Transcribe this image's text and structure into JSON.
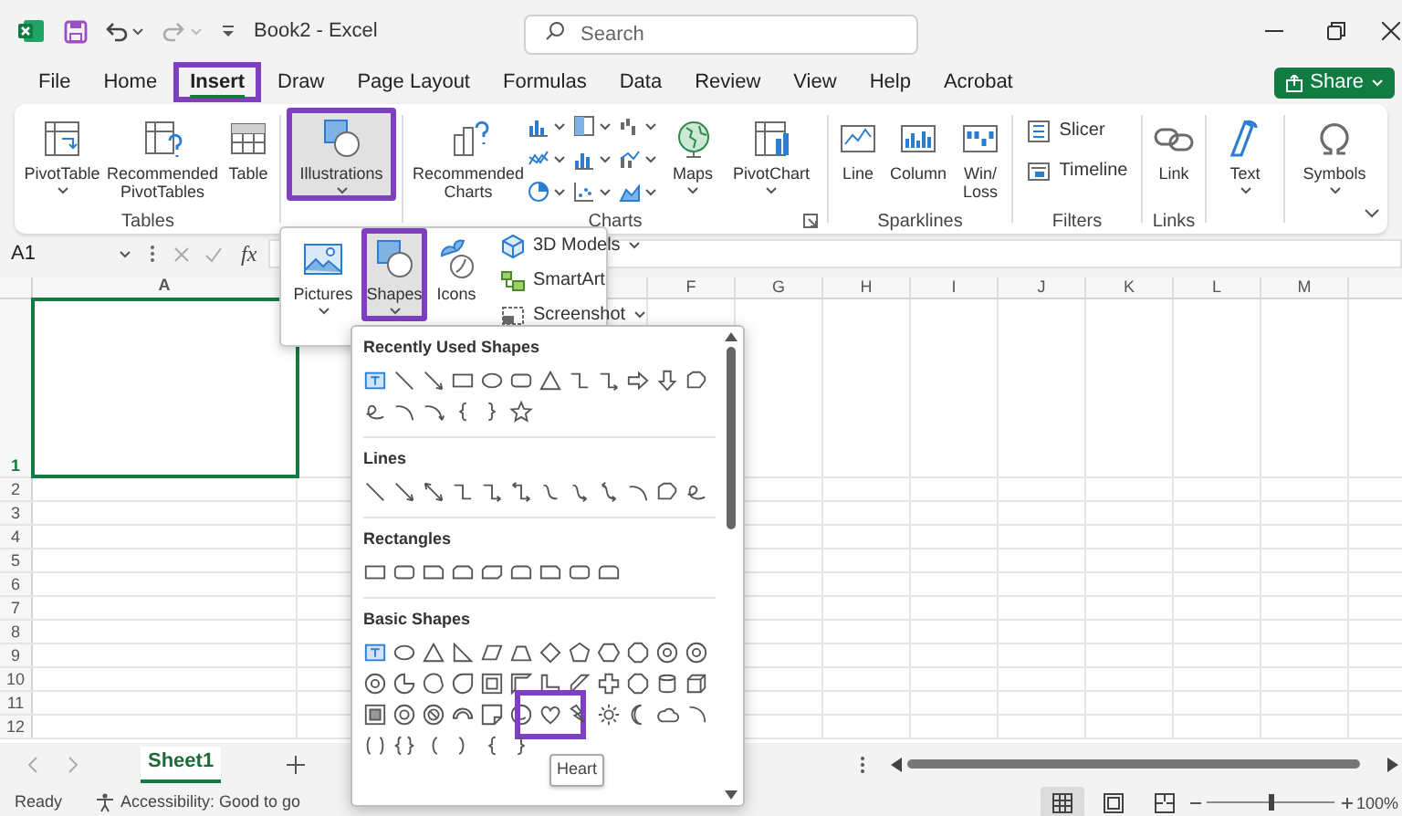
{
  "title_bar": {
    "title": "Book2 - Excel",
    "search": {
      "placeholder": "Search"
    }
  },
  "tabs": [
    {
      "label": "File",
      "selected": false,
      "highlighted": false
    },
    {
      "label": "Home",
      "selected": false,
      "highlighted": false
    },
    {
      "label": "Insert",
      "selected": true,
      "highlighted": true
    },
    {
      "label": "Draw",
      "selected": false,
      "highlighted": false
    },
    {
      "label": "Page Layout",
      "selected": false,
      "highlighted": false
    },
    {
      "label": "Formulas",
      "selected": false,
      "highlighted": false
    },
    {
      "label": "Data",
      "selected": false,
      "highlighted": false
    },
    {
      "label": "Review",
      "selected": false,
      "highlighted": false
    },
    {
      "label": "View",
      "selected": false,
      "highlighted": false
    },
    {
      "label": "Help",
      "selected": false,
      "highlighted": false
    },
    {
      "label": "Acrobat",
      "selected": false,
      "highlighted": false
    }
  ],
  "share_button": {
    "label": "Share"
  },
  "ribbon": {
    "groups": [
      {
        "label": "Tables",
        "launcher": false,
        "items": [
          {
            "kind": "large",
            "label": "PivotTable",
            "dropdown": true,
            "pressed": false,
            "highlighted": false
          },
          {
            "kind": "large",
            "label": "Recommended PivotTables",
            "dropdown": false,
            "pressed": false,
            "highlighted": false
          },
          {
            "kind": "large",
            "label": "Table",
            "dropdown": false,
            "pressed": false,
            "highlighted": false
          }
        ]
      },
      {
        "launcher": false,
        "items": [
          {
            "kind": "large",
            "label": "Illustrations",
            "dropdown": true,
            "pressed": true,
            "highlighted": true
          }
        ]
      },
      {
        "label": "Charts",
        "launcher": true,
        "items": [
          {
            "kind": "large",
            "label": "Recommended Charts",
            "dropdown": false,
            "pressed": false,
            "highlighted": false
          },
          {
            "kind": "chart-grid"
          },
          {
            "kind": "large",
            "label": "Maps",
            "dropdown": true,
            "pressed": false,
            "highlighted": false
          },
          {
            "kind": "large",
            "label": "PivotChart",
            "dropdown": true,
            "pressed": false,
            "highlighted": false
          }
        ]
      },
      {
        "label": "Sparklines",
        "launcher": false,
        "items": [
          {
            "kind": "large",
            "label": "Line",
            "dropdown": false,
            "pressed": false,
            "highlighted": false
          },
          {
            "kind": "large",
            "label": "Column",
            "dropdown": false,
            "pressed": false,
            "highlighted": false
          },
          {
            "kind": "large",
            "label": "Win/ Loss",
            "dropdown": false,
            "pressed": false,
            "highlighted": false
          }
        ]
      },
      {
        "label": "Filters",
        "launcher": false,
        "items": [
          {
            "kind": "small",
            "label": "Slicer",
            "dropdown": false,
            "pressed": false,
            "highlighted": false
          },
          {
            "kind": "small",
            "label": "Timeline",
            "dropdown": false,
            "pressed": false,
            "highlighted": false
          }
        ]
      },
      {
        "label": "Links",
        "launcher": false,
        "items": [
          {
            "kind": "large",
            "label": "Link",
            "dropdown": false,
            "pressed": false,
            "highlighted": false
          }
        ]
      },
      {
        "launcher": false,
        "items": [
          {
            "kind": "large",
            "label": "Text",
            "dropdown": true,
            "pressed": false,
            "highlighted": false
          }
        ]
      },
      {
        "launcher": false,
        "items": [
          {
            "kind": "large",
            "label": "Symbols",
            "dropdown": true,
            "pressed": false,
            "highlighted": false
          }
        ]
      }
    ]
  },
  "illustrations_menu": {
    "items": [
      {
        "kind": "large",
        "label": "Pictures",
        "dropdown": true,
        "pressed": false,
        "highlighted": false
      },
      {
        "kind": "large",
        "label": "Shapes",
        "dropdown": true,
        "pressed": true,
        "highlighted": true
      },
      {
        "kind": "large",
        "label": "Icons",
        "dropdown": false,
        "pressed": false,
        "highlighted": false
      },
      {
        "kind": "small",
        "label": "3D Models",
        "dropdown": true,
        "pressed": false,
        "highlighted": false
      },
      {
        "kind": "small",
        "label": "SmartArt",
        "dropdown": false,
        "pressed": false,
        "highlighted": false
      },
      {
        "kind": "small",
        "label": "Screenshot",
        "dropdown": true,
        "pressed": false,
        "highlighted": false
      }
    ]
  },
  "formula_bar": {
    "name_box": "A1",
    "function_label": "fx"
  },
  "grid": {
    "columns": [
      {
        "label": "A",
        "selected": true
      },
      {
        "label": "F",
        "selected": false
      },
      {
        "label": "G",
        "selected": false
      },
      {
        "label": "H",
        "selected": false
      },
      {
        "label": "I",
        "selected": false
      },
      {
        "label": "J",
        "selected": false
      },
      {
        "label": "K",
        "selected": false
      },
      {
        "label": "L",
        "selected": false
      },
      {
        "label": "M",
        "selected": false
      }
    ],
    "rows": [
      {
        "label": "1",
        "selected": true
      },
      {
        "label": "2",
        "selected": false
      },
      {
        "label": "3",
        "selected": false
      },
      {
        "label": "4",
        "selected": false
      },
      {
        "label": "5",
        "selected": false
      },
      {
        "label": "6",
        "selected": false
      },
      {
        "label": "7",
        "selected": false
      },
      {
        "label": "8",
        "selected": false
      },
      {
        "label": "9",
        "selected": false
      },
      {
        "label": "10",
        "selected": false
      },
      {
        "label": "11",
        "selected": false
      },
      {
        "label": "12",
        "selected": false
      }
    ]
  },
  "shapes_gallery": {
    "sections": [
      {
        "title": "Recently Used Shapes"
      },
      {
        "title": "Lines"
      },
      {
        "title": "Rectangles"
      },
      {
        "title": "Basic Shapes"
      }
    ],
    "hovered": {
      "highlighted": true,
      "tooltip": "Heart"
    }
  },
  "sheet_tabs": [
    {
      "label": "Sheet1",
      "selected": true
    }
  ],
  "status_bar": {
    "status": "Ready",
    "accessibility": "Accessibility: Good to go",
    "views": [
      {
        "selected": true
      },
      {
        "selected": false
      },
      {
        "selected": false
      }
    ],
    "zoom": {
      "level": 0.5,
      "reading": "100%"
    }
  }
}
